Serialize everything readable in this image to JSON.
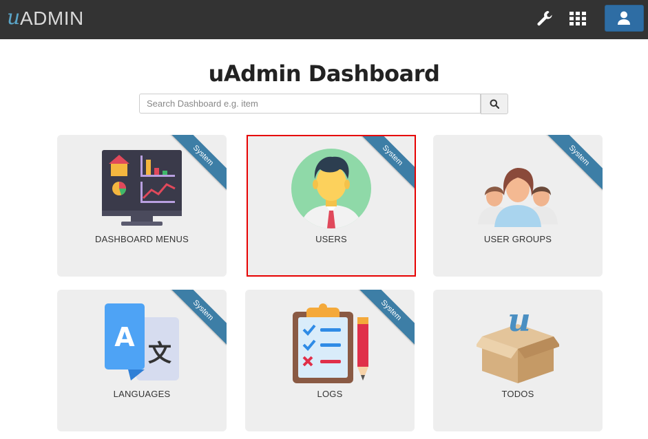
{
  "topbar": {
    "logo_u": "u",
    "logo_admin": "ADMIN",
    "icons": [
      "wrench-icon",
      "grid-icon",
      "user-icon"
    ]
  },
  "page": {
    "title": "uAdmin Dashboard"
  },
  "search": {
    "placeholder": "Search Dashboard e.g. item",
    "value": "",
    "button_icon": "search-icon"
  },
  "cards": [
    {
      "label": "DASHBOARD MENUS",
      "ribbon": "System",
      "icon": "dashboard-monitor-icon"
    },
    {
      "label": "USERS",
      "ribbon": "System",
      "icon": "user-avatar-icon",
      "selected": true
    },
    {
      "label": "USER GROUPS",
      "ribbon": "System",
      "icon": "user-group-icon"
    },
    {
      "label": "LANGUAGES",
      "ribbon": "System",
      "icon": "translate-icon"
    },
    {
      "label": "LOGS",
      "ribbon": "System",
      "icon": "clipboard-log-icon"
    },
    {
      "label": "TODOS",
      "ribbon": "",
      "icon": "package-box-icon"
    }
  ],
  "colors": {
    "topbar": "#333333",
    "user_button": "#2e6da4",
    "card_bg": "#eeeeee",
    "ribbon": "#3d7ea6",
    "selected_border": "#e60000"
  }
}
